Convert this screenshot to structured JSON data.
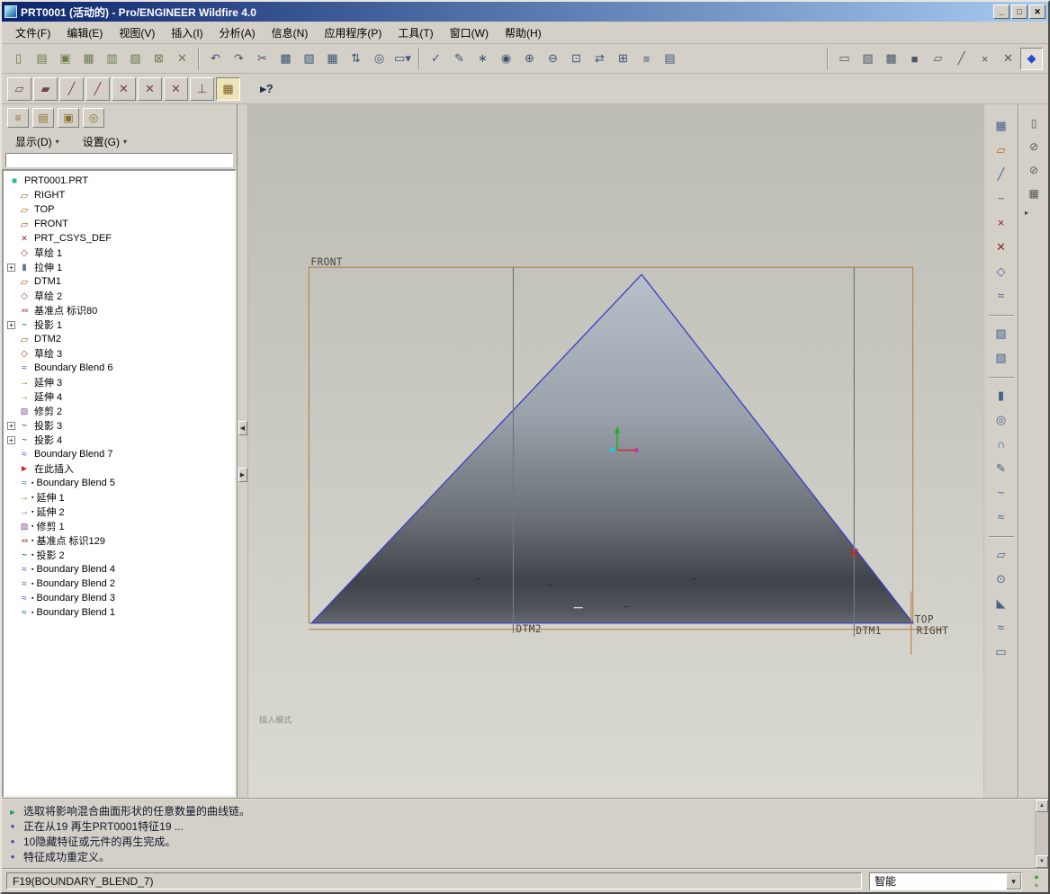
{
  "colors": {
    "chrome": "#d4d0c8",
    "titlebar-start": "#0b256d",
    "titlebar-end": "#a7caf0",
    "canvas-top": "#bcbcb4",
    "canvas-bottom": "#dadad2",
    "edge-blue": "#3c3cc8",
    "datum-brown": "#b27a38",
    "status-green": "#28b028"
  },
  "window": {
    "title": "PRT0001 (活动的) - Pro/ENGINEER Wildfire 4.0"
  },
  "titlebar_buttons": [
    {
      "name": "minimize-button",
      "glyph": "_"
    },
    {
      "name": "maximize-button",
      "glyph": "□"
    },
    {
      "name": "close-button",
      "glyph": "✕"
    }
  ],
  "menu": [
    {
      "name": "menu-file",
      "label": "文件(F)"
    },
    {
      "name": "menu-edit",
      "label": "编辑(E)"
    },
    {
      "name": "menu-view",
      "label": "视图(V)"
    },
    {
      "name": "menu-insert",
      "label": "插入(I)"
    },
    {
      "name": "menu-analysis",
      "label": "分析(A)"
    },
    {
      "name": "menu-info",
      "label": "信息(N)"
    },
    {
      "name": "menu-applications",
      "label": "应用程序(P)"
    },
    {
      "name": "menu-tools",
      "label": "工具(T)"
    },
    {
      "name": "menu-window",
      "label": "窗口(W)"
    },
    {
      "name": "menu-help",
      "label": "帮助(H)"
    }
  ],
  "toolbar_file": [
    {
      "name": "new-file-button",
      "glyph": "▯"
    },
    {
      "name": "open-file-button",
      "glyph": "▤"
    },
    {
      "name": "save-button",
      "glyph": "▣"
    },
    {
      "name": "save-copy-button",
      "glyph": "▦"
    },
    {
      "name": "print-button",
      "glyph": "▥"
    },
    {
      "name": "print-setup-button",
      "glyph": "▨"
    },
    {
      "name": "erase-display-button",
      "glyph": "⊠"
    },
    {
      "name": "delete-versions-button",
      "glyph": "✕"
    }
  ],
  "toolbar_edit": [
    {
      "name": "undo-button",
      "glyph": "↶"
    },
    {
      "name": "redo-button",
      "glyph": "↷"
    },
    {
      "name": "cut-button",
      "glyph": "✂"
    },
    {
      "name": "copy-button",
      "glyph": "▩"
    },
    {
      "name": "paste-button",
      "glyph": "▧"
    },
    {
      "name": "paste-special-button",
      "glyph": "▦"
    },
    {
      "name": "regenerate-button",
      "glyph": "⇅"
    },
    {
      "name": "find-button",
      "glyph": "◎"
    },
    {
      "name": "selection-filter-button",
      "glyph": "▭▾"
    }
  ],
  "toolbar_view": [
    {
      "name": "verify-button",
      "glyph": "✓"
    },
    {
      "name": "annotate-button",
      "glyph": "✎"
    },
    {
      "name": "spin-center-button",
      "glyph": "∗"
    },
    {
      "name": "orient-mode-button",
      "glyph": "◉"
    },
    {
      "name": "zoom-in-button",
      "glyph": "⊕"
    },
    {
      "name": "zoom-out-button",
      "glyph": "⊖"
    },
    {
      "name": "refit-button",
      "glyph": "⊡"
    },
    {
      "name": "reorient-button",
      "glyph": "⇄"
    },
    {
      "name": "saved-views-button",
      "glyph": "⊞"
    },
    {
      "name": "layers-button",
      "glyph": "≡"
    },
    {
      "name": "view-manager-button",
      "glyph": "▤"
    }
  ],
  "toolbar_display": [
    {
      "name": "wireframe-button",
      "glyph": "▭"
    },
    {
      "name": "hidden-line-button",
      "glyph": "▨"
    },
    {
      "name": "no-hidden-button",
      "glyph": "▩"
    },
    {
      "name": "shaded-button",
      "glyph": "■"
    },
    {
      "name": "datum-planes-toggle",
      "glyph": "▱"
    },
    {
      "name": "datum-axes-toggle",
      "glyph": "╱"
    },
    {
      "name": "datum-points-toggle",
      "glyph": "×"
    },
    {
      "name": "datum-csys-toggle",
      "glyph": "✕"
    },
    {
      "name": "shading-toggle",
      "glyph": "◆",
      "state": "active"
    }
  ],
  "toolbar_sketch": [
    {
      "name": "datum-display-button",
      "glyph": "▱"
    },
    {
      "name": "datum-fill-display-button",
      "glyph": "▰"
    },
    {
      "name": "axis-display-button",
      "glyph": "╱"
    },
    {
      "name": "axis-tag-display-button",
      "glyph": "╱"
    },
    {
      "name": "point-display-button",
      "glyph": "✕"
    },
    {
      "name": "point-tag-display-button",
      "glyph": "✕"
    },
    {
      "name": "csys-display-button",
      "glyph": "✕"
    },
    {
      "name": "vertex-display-button",
      "glyph": "⊥"
    },
    {
      "name": "grid-toggle-button",
      "glyph": "▦",
      "state": "active"
    }
  ],
  "context_help": {
    "glyph": "▸?"
  },
  "tree_toolbar": [
    {
      "name": "model-tree-toggle-button",
      "glyph": "≡"
    },
    {
      "name": "folder-browser-button",
      "glyph": "▤"
    },
    {
      "name": "favorites-button",
      "glyph": "▣"
    },
    {
      "name": "connections-button",
      "glyph": "◎"
    }
  ],
  "tree_menus": [
    {
      "name": "show-menu",
      "label": "显示(D)"
    },
    {
      "name": "settings-menu",
      "label": "设置(G)"
    }
  ],
  "model_tree": [
    {
      "ind": "root",
      "icon": "part",
      "label": "PRT0001.PRT"
    },
    {
      "ind": "child",
      "icon": "datum-plane",
      "label": "RIGHT"
    },
    {
      "ind": "child",
      "icon": "datum-plane",
      "label": "TOP"
    },
    {
      "ind": "child",
      "icon": "datum-plane",
      "label": "FRONT"
    },
    {
      "ind": "child",
      "icon": "csys",
      "label": "PRT_CSYS_DEF"
    },
    {
      "ind": "child",
      "icon": "sketch",
      "label": "草绘 1"
    },
    {
      "ind": "child",
      "icon": "extrude",
      "label": "拉伸 1",
      "expand": "+"
    },
    {
      "ind": "child",
      "icon": "datum-plane",
      "label": "DTM1"
    },
    {
      "ind": "child",
      "icon": "sketch",
      "label": "草绘 2"
    },
    {
      "ind": "child",
      "icon": "datum-point",
      "label": "基准点 标识80"
    },
    {
      "ind": "child",
      "icon": "projection",
      "label": "投影 1",
      "expand": "+"
    },
    {
      "ind": "child",
      "icon": "datum-plane",
      "label": "DTM2"
    },
    {
      "ind": "child",
      "icon": "sketch",
      "label": "草绘 3"
    },
    {
      "ind": "child",
      "icon": "blend",
      "label": "Boundary Blend 6"
    },
    {
      "ind": "child",
      "icon": "extend",
      "label": "延伸 3"
    },
    {
      "ind": "child",
      "icon": "extend",
      "label": "延伸 4"
    },
    {
      "ind": "child",
      "icon": "trim",
      "label": "修剪 2"
    },
    {
      "ind": "child",
      "icon": "projection",
      "label": "投影 3",
      "expand": "+"
    },
    {
      "ind": "child",
      "icon": "projection",
      "label": "投影 4",
      "expand": "+"
    },
    {
      "ind": "child",
      "icon": "blend",
      "label": "Boundary Blend 7"
    },
    {
      "ind": "child",
      "icon": "insert-arrow",
      "label": "在此插入"
    },
    {
      "ind": "child",
      "icon": "blend",
      "label": "Boundary Blend 5",
      "mark": "▪"
    },
    {
      "ind": "child",
      "icon": "extend",
      "label": "延伸 1",
      "mark": "▪"
    },
    {
      "ind": "child",
      "icon": "extend",
      "label": "延伸 2",
      "mark": "▪"
    },
    {
      "ind": "child",
      "icon": "trim",
      "label": "修剪 1",
      "mark": "▪"
    },
    {
      "ind": "child",
      "icon": "datum-point",
      "label": "基准点 标识129",
      "mark": "▪"
    },
    {
      "ind": "child",
      "icon": "projection",
      "label": "投影 2",
      "mark": "▪"
    },
    {
      "ind": "child",
      "icon": "blend",
      "label": "Boundary Blend 4",
      "mark": "▪"
    },
    {
      "ind": "child",
      "icon": "blend",
      "label": "Boundary Blend 2",
      "mark": "▪"
    },
    {
      "ind": "child",
      "icon": "blend",
      "label": "Boundary Blend 3",
      "mark": "▪"
    },
    {
      "ind": "child",
      "icon": "blend",
      "label": "Boundary Blend 1",
      "mark": "▪"
    }
  ],
  "splitter": {
    "collapse": "◀",
    "expand": "▶"
  },
  "graphics": {
    "labels": {
      "front": "FRONT",
      "dtm2": "DTM2",
      "dtm1": "DTM1",
      "top": "TOP",
      "right": "RIGHT"
    },
    "mode_text": "插入模式"
  },
  "right_datum_tools": [
    {
      "name": "style-states-tool",
      "glyph": "▦"
    },
    {
      "name": "datum-plane-tool",
      "glyph": "▱"
    },
    {
      "name": "datum-axis-tool",
      "glyph": "╱"
    },
    {
      "name": "datum-curve-tool",
      "glyph": "~"
    },
    {
      "name": "datum-point-tool",
      "glyph": "×"
    },
    {
      "name": "datum-csys-tool",
      "glyph": "✕"
    },
    {
      "name": "sketch-tool",
      "glyph": "◇"
    },
    {
      "name": "analysis-display-tool",
      "glyph": "≈"
    }
  ],
  "right_surface_tools": [
    {
      "name": "copy-geometry-tool",
      "glyph": "▨"
    },
    {
      "name": "offset-surface-tool",
      "glyph": "▧"
    }
  ],
  "right_feature_tools": [
    {
      "name": "extrude-tool",
      "glyph": "▮"
    },
    {
      "name": "revolve-tool",
      "glyph": "◎"
    },
    {
      "name": "boundary-blend-tool",
      "glyph": "∩"
    },
    {
      "name": "sweep-tool",
      "glyph": "✎"
    },
    {
      "name": "curve-tool",
      "glyph": "~"
    },
    {
      "name": "wrap-tool",
      "glyph": "≈"
    }
  ],
  "right_modify_tools": [
    {
      "name": "mirror-tool",
      "glyph": "▱"
    },
    {
      "name": "merge-tool",
      "glyph": "⊙"
    },
    {
      "name": "trim-tool",
      "glyph": "◣"
    },
    {
      "name": "pattern-tool",
      "glyph": "≈"
    },
    {
      "name": "flatten-tool",
      "glyph": "▭"
    }
  ],
  "right_dock": [
    {
      "name": "window-dock-button",
      "glyph": "▯"
    },
    {
      "name": "clip-toggle-button",
      "glyph": "⊘"
    },
    {
      "name": "spin-toggle-button",
      "glyph": "⊘"
    },
    {
      "name": "grid-dock-button",
      "glyph": "▦"
    }
  ],
  "dock_expand": {
    "glyph": "▸"
  },
  "messages": [
    {
      "kind": "prompt",
      "text": "选取将影响混合曲面形状的任意数量的曲线链。"
    },
    {
      "kind": "info",
      "text": "正在从19 再生PRT0001特征19 ..."
    },
    {
      "kind": "info",
      "text": "10隐藏特征或元件的再生完成。"
    },
    {
      "kind": "info",
      "text": "特征成功重定义。"
    }
  ],
  "status": {
    "left": "F19(BOUNDARY_BLEND_7)",
    "filter_value": "智能"
  }
}
